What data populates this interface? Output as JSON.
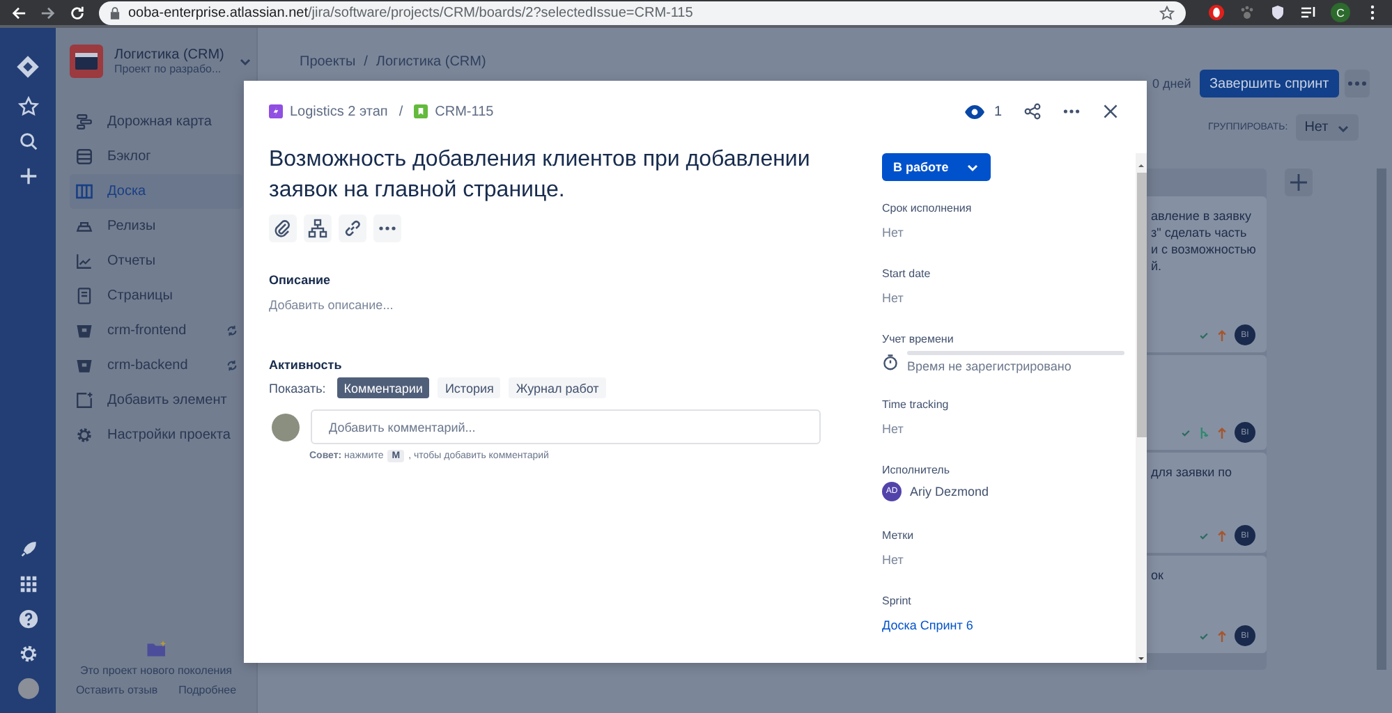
{
  "browser": {
    "url_host": "ooba-enterprise.atlassian.net",
    "url_path": "/jira/software/projects/CRM/boards/2?selectedIssue=CRM-115",
    "profile_initial": "C"
  },
  "project": {
    "name": "Логистика (CRM)",
    "subtitle": "Проект по разрабо..."
  },
  "sidebar": {
    "items": [
      {
        "kind": "roadmap",
        "label": "Дорожная карта",
        "selected": false,
        "sync": false
      },
      {
        "kind": "backlog",
        "label": "Бэклог",
        "selected": false,
        "sync": false
      },
      {
        "kind": "board",
        "label": "Доска",
        "selected": true,
        "sync": false
      },
      {
        "kind": "releases",
        "label": "Релизы",
        "selected": false,
        "sync": false
      },
      {
        "kind": "reports",
        "label": "Отчеты",
        "selected": false,
        "sync": false
      },
      {
        "kind": "pages",
        "label": "Страницы",
        "selected": false,
        "sync": false
      },
      {
        "kind": "repo",
        "label": "crm-frontend",
        "selected": false,
        "sync": true
      },
      {
        "kind": "repo",
        "label": "crm-backend",
        "selected": false,
        "sync": true
      },
      {
        "kind": "add",
        "label": "Добавить элемент",
        "selected": false,
        "sync": false
      },
      {
        "kind": "settings",
        "label": "Настройки проекта",
        "selected": false,
        "sync": false
      }
    ],
    "footer_text": "Это проект нового поколения",
    "footer_links": [
      "Оставить отзыв",
      "Подробнее"
    ]
  },
  "board": {
    "breadcrumbs": [
      "Проекты",
      "Логистика (CRM)"
    ],
    "breadcrumb_separator": "/",
    "days_left": "0 дней",
    "complete_button": "Завершить спринт",
    "group_label": "ГРУППИРОВАТЬ:",
    "group_value": "Нет",
    "cards": [
      {
        "text": "авление в заявку\nз\" сделать часть\nи с возможностью\nй.",
        "branch": false,
        "assignee": "BI"
      },
      {
        "branch": true,
        "assignee": "BI"
      },
      {
        "text": "для заявки по",
        "branch": false,
        "assignee": "BI"
      },
      {
        "text": "ок",
        "branch": false,
        "assignee": "BI"
      }
    ]
  },
  "issue": {
    "breadcrumbs": [
      {
        "kind": "epic",
        "label": "Logistics 2 этап"
      },
      {
        "kind": "story",
        "label": "CRM-115"
      }
    ],
    "breadcrumb_separator": "/",
    "watchers": "1",
    "title": "Возможность добавления клиентов при добавлении заявок на главной странице.",
    "description": {
      "label": "Описание",
      "placeholder": "Добавить описание..."
    },
    "activity": {
      "label": "Активность",
      "show_label": "Показать:",
      "filters": [
        {
          "label": "Комментарии",
          "selected": true
        },
        {
          "label": "История",
          "selected": false
        },
        {
          "label": "Журнал работ",
          "selected": false
        }
      ],
      "comment_placeholder": "Добавить комментарий...",
      "tip_before": "**Совет:** нажмите",
      "tip_key": "M",
      "tip_after": ", чтобы добавить комментарий"
    },
    "status": "В работе",
    "fields": [
      {
        "kind": "text",
        "label": "Срок исполнения",
        "value": "Нет"
      },
      {
        "kind": "text",
        "label": "Start date",
        "value": "Нет"
      },
      {
        "kind": "time",
        "label": "Учет времени",
        "value": "Время не зарегистрировано",
        "level": 0
      },
      {
        "kind": "text",
        "label": "Time tracking",
        "value": "Нет"
      },
      {
        "kind": "user",
        "label": "Исполнитель",
        "initials": "AD",
        "value": "Ariy Dezmond"
      },
      {
        "kind": "text",
        "label": "Метки",
        "value": "Нет"
      },
      {
        "kind": "link",
        "label": "Sprint",
        "value": "Доска Спринт 6"
      }
    ]
  }
}
